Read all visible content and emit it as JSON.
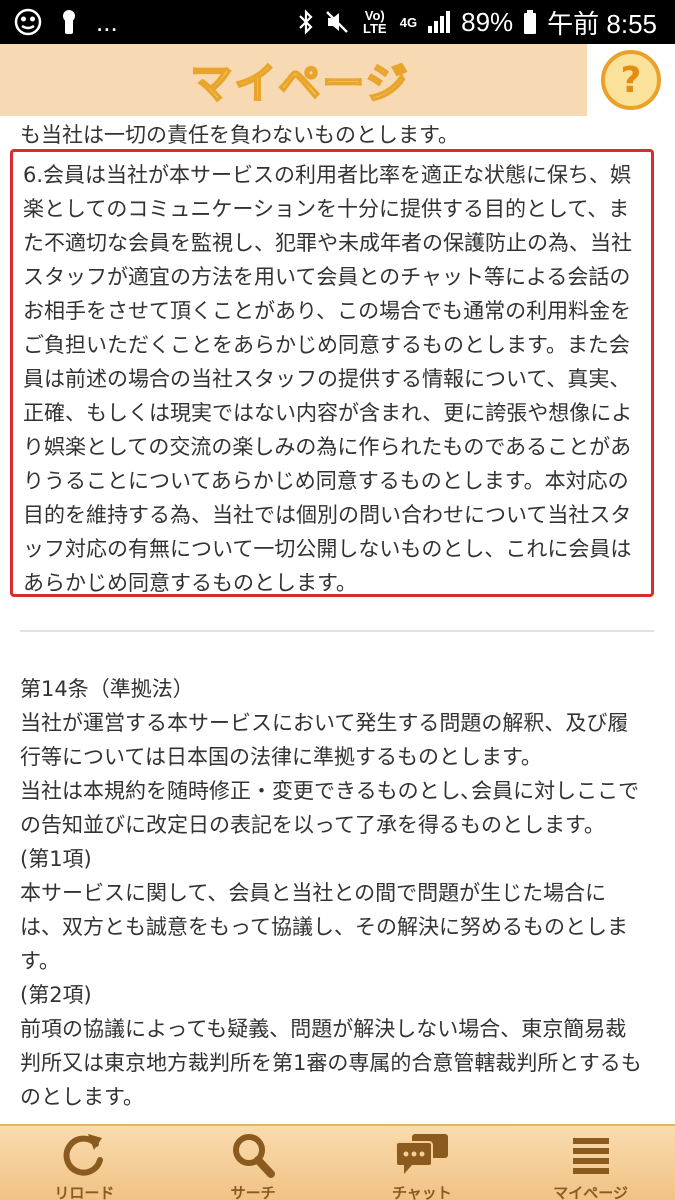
{
  "status_bar": {
    "network_type": "4G",
    "volte_label": "Vo) LTE",
    "battery": "89%",
    "time": "午前 8:55",
    "notifications": "..."
  },
  "header": {
    "title": "マイページ",
    "help_label": "?"
  },
  "content": {
    "prev_line": "も当社は一切の責任を負わないものとします。",
    "highlight_lines": [
      "6.会員は当社が本サービスの利用者比率を適正な状態に保ち、娯",
      "楽としてのコミュニケーションを十分に提供する目的として、ま",
      "た不適切な会員を監視し、犯罪や未成年者の保護防止の為、当社",
      "スタッフが適宜の方法を用いて会員とのチャット等による会話の",
      "お相手をさせて頂くことがあり、この場合でも通常の利用料金を",
      "ご負担いただくことをあらかじめ同意するものとします。また会",
      "員は前述の場合の当社スタッフの提供する情報について、真実、",
      "正確、もしくは現実ではない内容が含まれ、更に誇張や想像によ",
      "り娯楽としての交流の楽しみの為に作られたものであることがあ",
      "りうることについてあらかじめ同意するものとします。本対応の",
      "目的を維持する為、当社では個別の問い合わせについて当社スタ",
      "ッフ対応の有無について一切公開しないものとし、これに会員は",
      "あらかじめ同意するものとします。"
    ],
    "article_lines": [
      "第14条（準拠法）",
      "当社が運営する本サービスにおいて発生する問題の解釈、及び履",
      "行等については日本国の法律に準拠するものとします。",
      "当社は本規約を随時修正・変更できるものとし､会員に対しここで",
      "の告知並びに改定日の表記を以って了承を得るものとします。",
      "(第1項)",
      "本サービスに関して、会員と当社との間で問題が生じた場合に",
      "は、双方とも誠意をもって協議し、その解決に努めるものとしま",
      "す。",
      "(第2項)",
      "前項の協議によっても疑義、問題が解決しない場合、東京簡易裁",
      "判所又は東京地方裁判所を第1審の専属的合意管轄裁判所とするも",
      "のとします。"
    ]
  },
  "tabs": [
    {
      "label": "リロード",
      "icon": "reload-icon"
    },
    {
      "label": "サーチ",
      "icon": "search-icon"
    },
    {
      "label": "チャット",
      "icon": "chat-icon"
    },
    {
      "label": "マイページ",
      "icon": "list-icon"
    }
  ],
  "colors": {
    "header_bg": "#f7dab3",
    "tab_bg": "#f1c285",
    "highlight_border": "#d82d2d",
    "icon_brown": "#8b5a1e"
  }
}
